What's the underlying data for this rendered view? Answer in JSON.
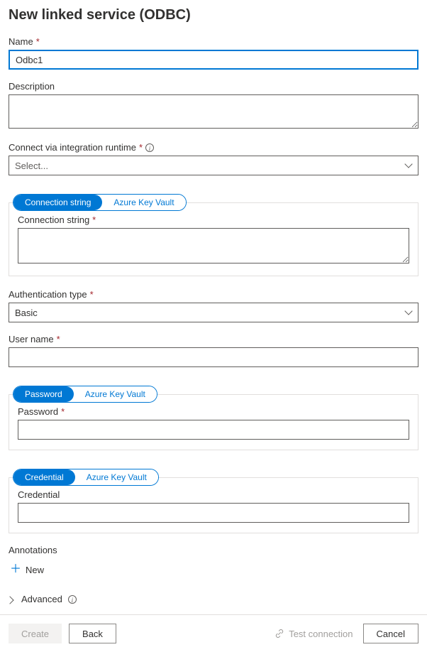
{
  "title": "New linked service (ODBC)",
  "fields": {
    "name": {
      "label": "Name",
      "value": "Odbc1"
    },
    "description": {
      "label": "Description",
      "value": ""
    },
    "runtime": {
      "label": "Connect via integration runtime",
      "placeholder": "Select..."
    },
    "connTabs": {
      "a": "Connection string",
      "b": "Azure Key Vault"
    },
    "connString": {
      "label": "Connection string",
      "value": ""
    },
    "authType": {
      "label": "Authentication type",
      "value": "Basic"
    },
    "userName": {
      "label": "User name",
      "value": ""
    },
    "pwdTabs": {
      "a": "Password",
      "b": "Azure Key Vault"
    },
    "password": {
      "label": "Password",
      "value": ""
    },
    "credTabs": {
      "a": "Credential",
      "b": "Azure Key Vault"
    },
    "credential": {
      "label": "Credential",
      "value": ""
    },
    "annotations": {
      "label": "Annotations",
      "new": "New"
    },
    "advanced": {
      "label": "Advanced"
    }
  },
  "footer": {
    "create": "Create",
    "back": "Back",
    "test": "Test connection",
    "cancel": "Cancel"
  }
}
